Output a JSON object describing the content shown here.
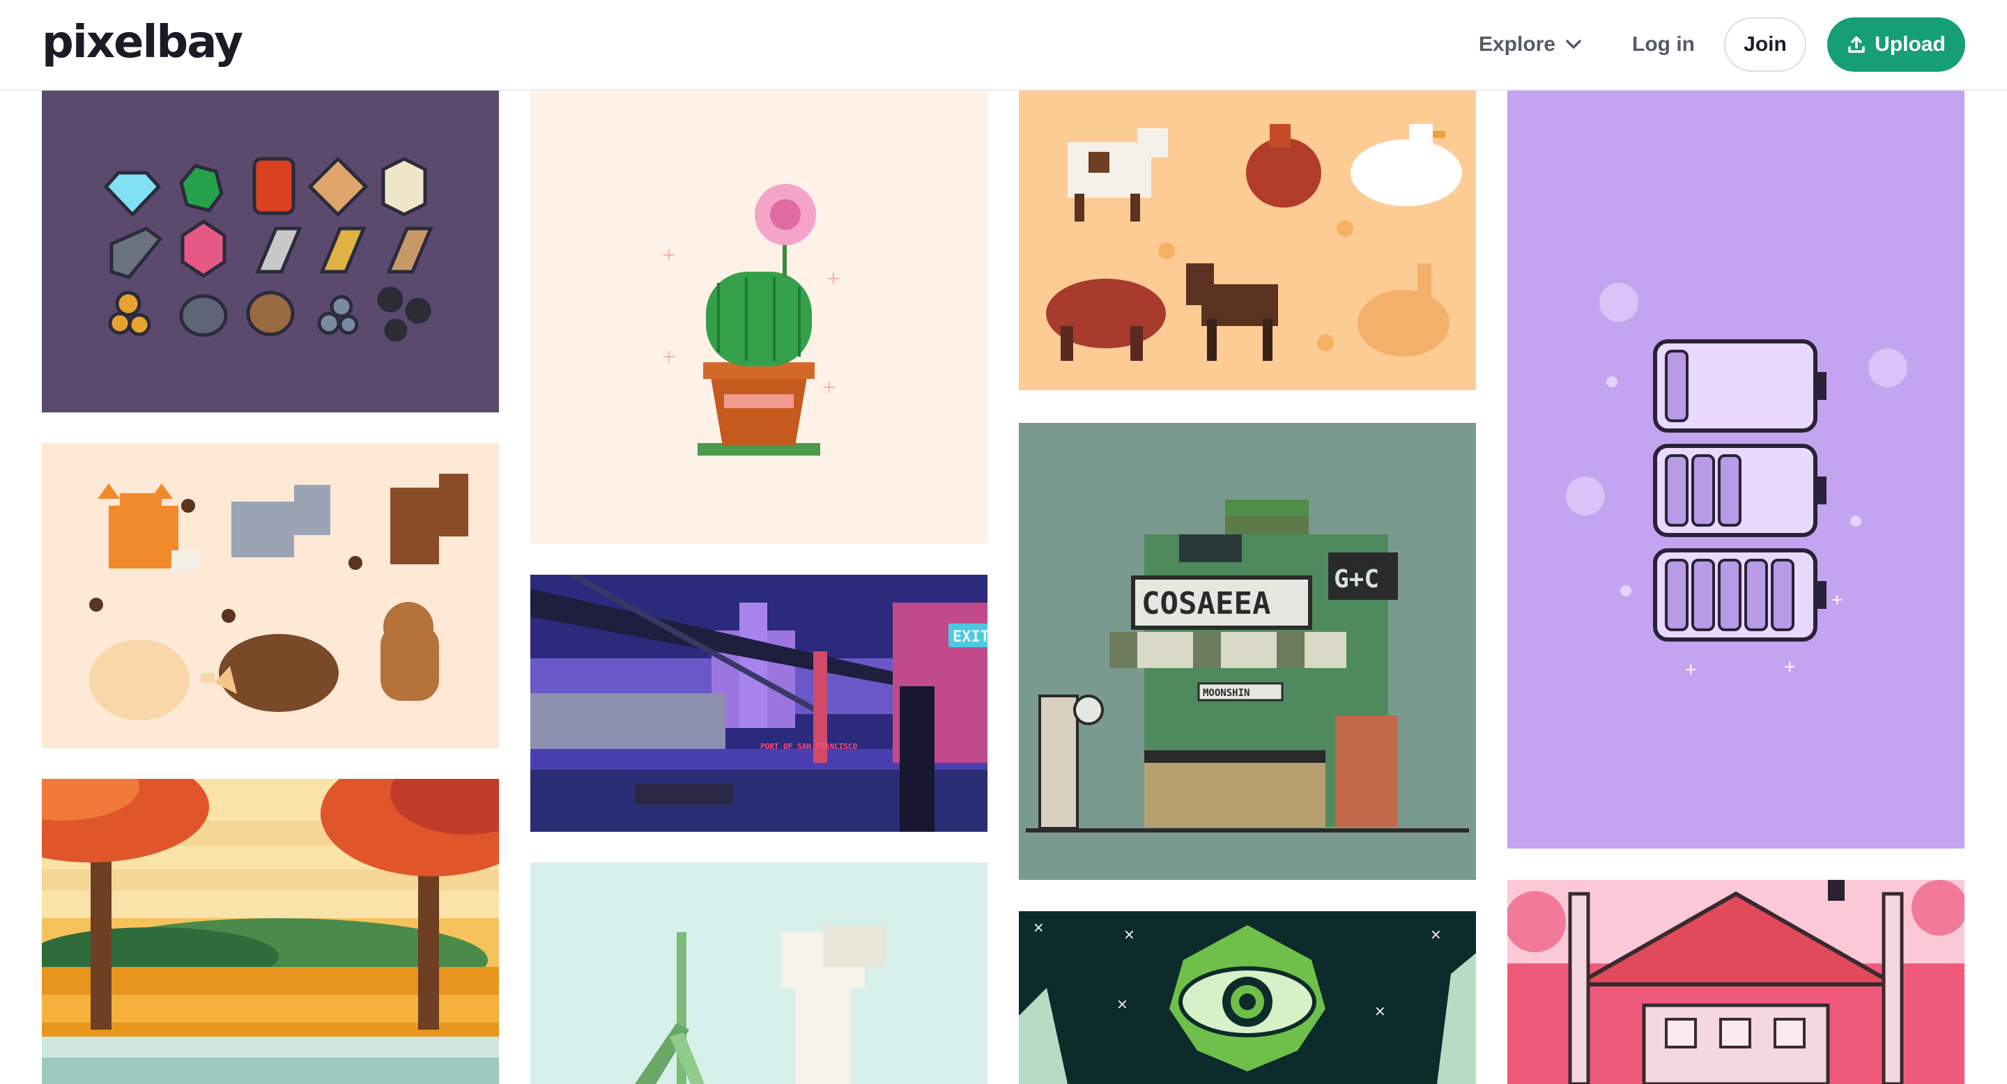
{
  "brand": {
    "name": "pixelbay"
  },
  "nav": {
    "explore_label": "Explore",
    "login_label": "Log in",
    "join_label": "Join",
    "upload_label": "Upload"
  },
  "icons": {
    "explore": "chevron-down-icon",
    "upload": "upload-icon"
  },
  "colors": {
    "accent": "#169e74",
    "text": "#191b26",
    "muted": "#545a66"
  },
  "gallery": {
    "columns": [
      {
        "items": [
          {
            "subject": "gems-and-ores",
            "background": "#5b4a6e"
          },
          {
            "subject": "forest-animals",
            "background": "#fde9d6"
          },
          {
            "subject": "autumn-landscape",
            "background": "#f5c25c"
          }
        ]
      },
      {
        "items": [
          {
            "subject": "potted-cactus",
            "background": "#fdf1e8"
          },
          {
            "subject": "city-bridge-night",
            "background": "#2d2f8a",
            "sign_text": "EXIT",
            "caption_text": "PORT OF SAN FRANCISCO"
          },
          {
            "subject": "white-flower",
            "background": "#d8f0ea"
          }
        ]
      },
      {
        "items": [
          {
            "subject": "farm-animals",
            "background": "#fdcb94"
          },
          {
            "subject": "street-shop",
            "background": "#7b9a8f",
            "shop_sign": "COSAEEA",
            "shop_sign2": "G+C",
            "shop_label": "MOONSHIN"
          },
          {
            "subject": "cosmic-eye",
            "background": "#0d2b2a"
          }
        ]
      },
      {
        "items": [
          {
            "subject": "battery-levels",
            "background": "#c4a4f0"
          },
          {
            "subject": "pink-house",
            "background": "#fbc9d6"
          }
        ]
      }
    ]
  }
}
